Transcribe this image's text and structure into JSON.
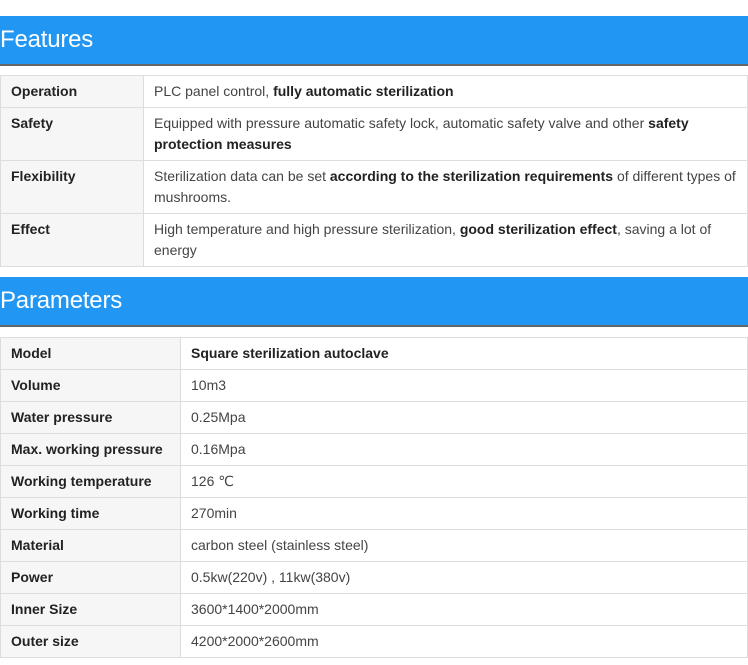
{
  "features": {
    "title": "Features",
    "rows": [
      {
        "key": "Operation",
        "parts": [
          {
            "t": "PLC panel control, ",
            "b": false
          },
          {
            "t": "fully automatic sterilization",
            "b": true
          }
        ]
      },
      {
        "key": "Safety",
        "parts": [
          {
            "t": "Equipped with pressure automatic safety lock, automatic safety valve and other ",
            "b": false
          },
          {
            "t": "safety protection measures",
            "b": true
          }
        ]
      },
      {
        "key": "Flexibility",
        "parts": [
          {
            "t": "Sterilization data can be set ",
            "b": false
          },
          {
            "t": "according to the sterilization requirements",
            "b": true
          },
          {
            "t": " of different types of mushrooms.",
            "b": false
          }
        ]
      },
      {
        "key": "Effect",
        "parts": [
          {
            "t": "High temperature and high pressure sterilization, ",
            "b": false
          },
          {
            "t": "good sterilization effect",
            "b": true
          },
          {
            "t": ", saving a lot of energy",
            "b": false
          }
        ]
      }
    ]
  },
  "parameters": {
    "title": "Parameters",
    "rows": [
      {
        "key": "Model",
        "value": "Square sterilization autoclave",
        "bold": true
      },
      {
        "key": "Volume",
        "value": "10m3"
      },
      {
        "key": "Water pressure",
        "value": "0.25Mpa"
      },
      {
        "key": "Max. working pressure",
        "value": "0.16Mpa"
      },
      {
        "key": "Working temperature",
        "value": "126 ℃"
      },
      {
        "key": "Working time",
        "value": "270min"
      },
      {
        "key": "Material",
        "value": "carbon steel (stainless steel)"
      },
      {
        "key": "Power",
        "value": "0.5kw(220v) , 11kw(380v)"
      },
      {
        "key": "Inner Size",
        "value": "3600*1400*2000mm"
      },
      {
        "key": "Outer size",
        "value": "4200*2000*2600mm"
      }
    ]
  }
}
